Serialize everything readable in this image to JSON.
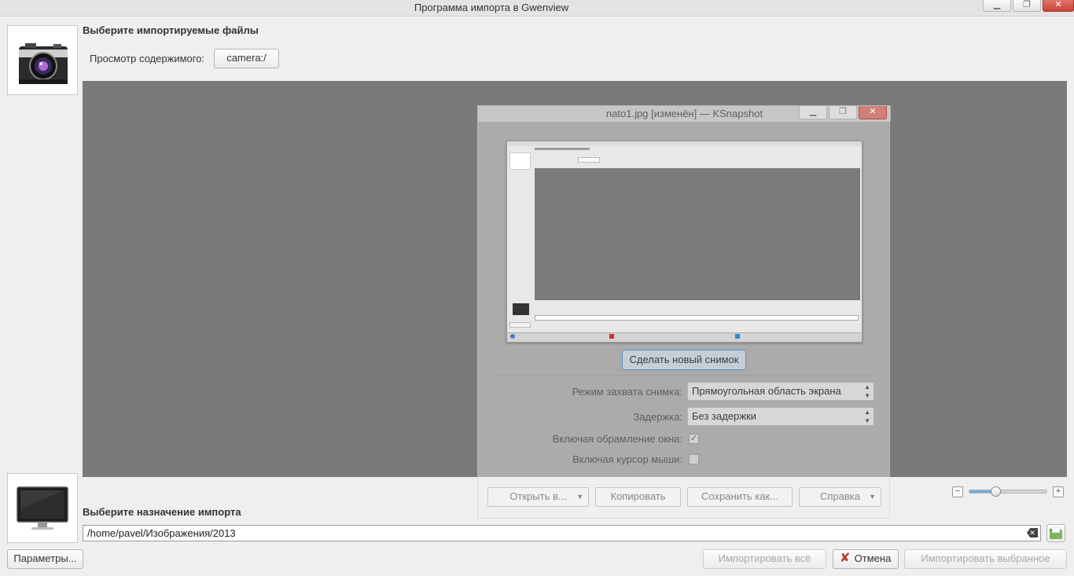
{
  "window": {
    "title": "Программа импорта в Gwenview"
  },
  "source": {
    "heading": "Выберите импортируемые файлы",
    "browse_label": "Просмотр содержимого:",
    "location_button": "camera:/"
  },
  "preview_dialog": {
    "title": "nato1.jpg [изменён] — KSnapshot",
    "new_snapshot_button": "Сделать новый снимок",
    "capture_mode_label": "Режим захвата снимка:",
    "capture_mode_value": "Прямоугольная область экрана",
    "delay_label": "Задержка:",
    "delay_value": "Без задержки",
    "include_decorations_label": "Включая обрамление окна:",
    "include_decorations_checked": true,
    "include_pointer_label": "Включая курсор мыши:",
    "include_pointer_checked": false,
    "open_with_button": "Открыть в...",
    "copy_button": "Копировать",
    "save_as_button": "Сохранить как...",
    "help_button": "Справка"
  },
  "zoom": {
    "level": 0.34
  },
  "destination": {
    "heading": "Выберите назначение импорта",
    "path": "/home/pavel/Изображения/2013"
  },
  "footer": {
    "settings_button": "Параметры...",
    "import_all_button": "Импортировать всё",
    "cancel_button": "Отмена",
    "import_selected_button": "Импортировать выбранное"
  },
  "colors": {
    "accent": "#5ba3d9",
    "cancel_red": "#c0392b"
  }
}
